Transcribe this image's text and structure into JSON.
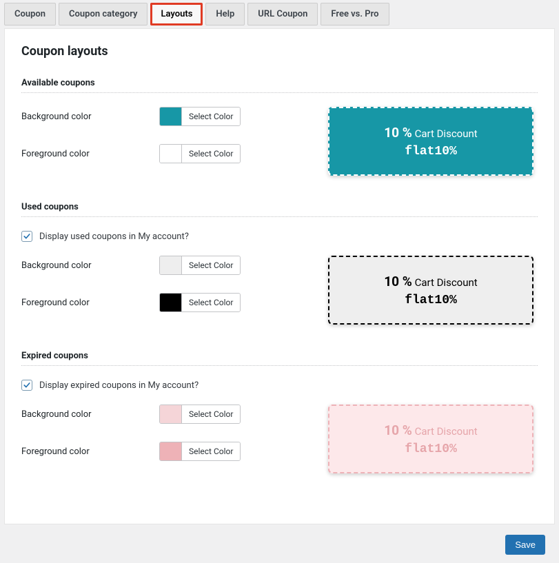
{
  "tabs": {
    "coupon": "Coupon",
    "category": "Coupon category",
    "layouts": "Layouts",
    "help": "Help",
    "url": "URL Coupon",
    "free": "Free vs. Pro"
  },
  "panel": {
    "title": "Coupon layouts"
  },
  "sections": {
    "available": {
      "title": "Available coupons",
      "bg_label": "Background color",
      "fg_label": "Foreground color",
      "bg_color": "#1797a6",
      "fg_color": "#ffffff",
      "select_btn": "Select Color"
    },
    "used": {
      "title": "Used coupons",
      "check_label": "Display used coupons in My account?",
      "bg_label": "Background color",
      "fg_label": "Foreground color",
      "bg_color": "#eeeeee",
      "fg_color": "#000000",
      "select_btn": "Select Color"
    },
    "expired": {
      "title": "Expired coupons",
      "check_label": "Display expired coupons in My account?",
      "bg_label": "Background color",
      "fg_label": "Foreground color",
      "bg_color": "#f5d5d8",
      "fg_color": "#eeb2b7",
      "select_btn": "Select Color"
    }
  },
  "preview": {
    "percent": "10 %",
    "label": "Cart Discount",
    "code": "flat10%"
  },
  "save": {
    "label": "Save"
  },
  "colors": {
    "available_card_bg": "#1797a6",
    "available_card_border": "#ffffff",
    "available_card_text": "#ffffff",
    "used_card_bg": "#eeeeee",
    "used_card_border": "#000000",
    "used_card_text": "#000000",
    "expired_card_bg": "#fde8ea",
    "expired_card_border": "#eeb2b7",
    "expired_card_text": "#e6a5aa"
  }
}
